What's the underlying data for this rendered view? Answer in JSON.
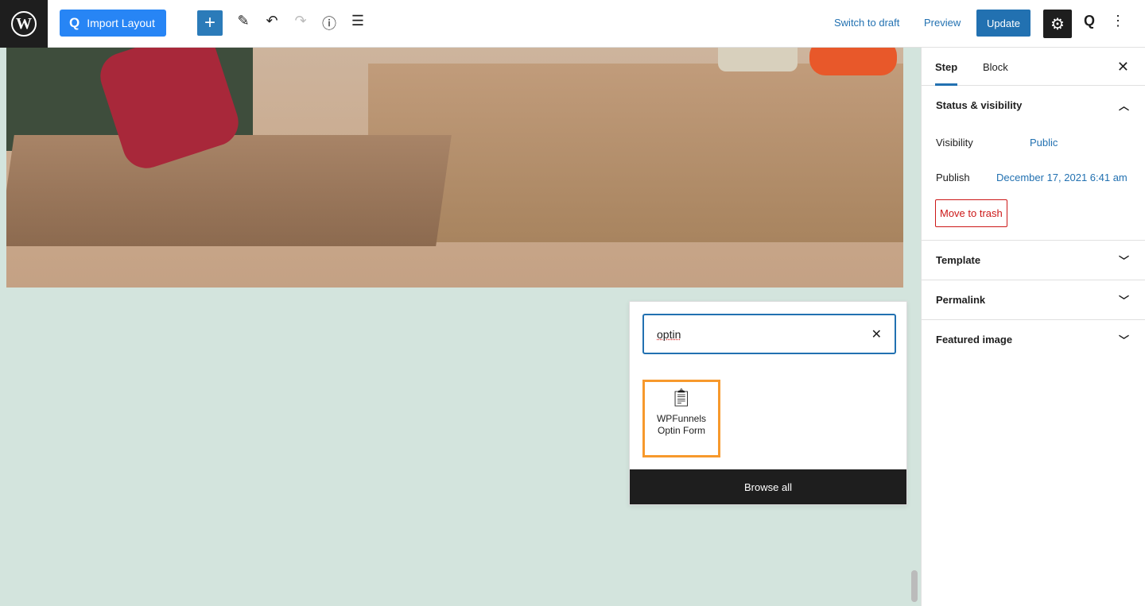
{
  "toolbar": {
    "import_label": "Import Layout",
    "switch_draft": "Switch to draft",
    "preview": "Preview",
    "update": "Update"
  },
  "inserter": {
    "search_value": "optin",
    "result_label": "WPFunnels Optin Form",
    "browse_all": "Browse all"
  },
  "sidebar": {
    "tabs": [
      {
        "label": "Step"
      },
      {
        "label": "Block"
      }
    ],
    "status_title": "Status & visibility",
    "visibility_label": "Visibility",
    "visibility_value": "Public",
    "publish_label": "Publish",
    "publish_value": "December 17, 2021 6:41 am",
    "trash": "Move to trash",
    "panels": [
      {
        "label": "Template"
      },
      {
        "label": "Permalink"
      },
      {
        "label": "Featured image"
      }
    ]
  },
  "colors": {
    "accent": "#2271b1",
    "highlight": "#f7992c",
    "canvas": "#d3e4dd"
  }
}
